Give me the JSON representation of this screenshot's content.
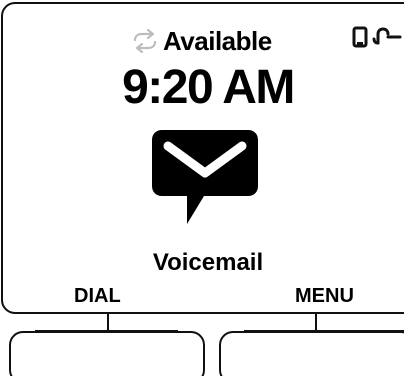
{
  "status": {
    "presence_icon": "presence-sync-icon",
    "text": "Available",
    "device_icons": [
      "handset-icon",
      "headset-icon"
    ]
  },
  "clock": {
    "time": "9:20 AM"
  },
  "notification": {
    "icon": "voicemail-envelope-icon",
    "label": "Voicemail"
  },
  "softkeys": {
    "left_label": "DIAL",
    "right_label": "MENU"
  },
  "colors": {
    "foreground": "#000000",
    "background": "#ffffff"
  }
}
